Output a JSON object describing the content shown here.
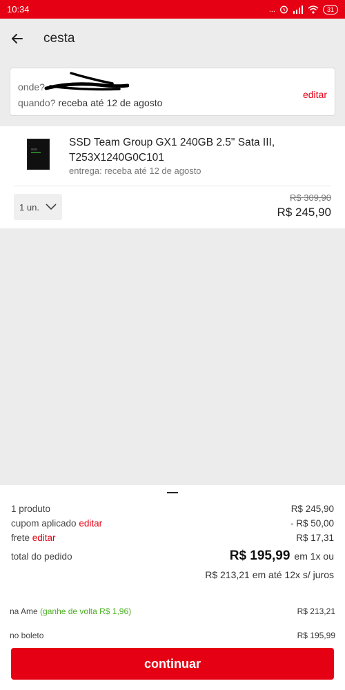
{
  "status_bar": {
    "time": "10:34",
    "dots": "...",
    "battery": "31"
  },
  "header": {
    "title": "cesta"
  },
  "delivery": {
    "where_label": "onde?",
    "when_label": "quando?",
    "when_value": "receba até 12 de agosto",
    "edit_label": "editar"
  },
  "product": {
    "name_line1": "SSD Team Group GX1 240GB 2.5\" Sata III,",
    "name_line2": "T253X1240G0C101",
    "delivery": "entrega: receba até 12 de agosto",
    "quantity": "1 un.",
    "old_price": "R$ 309,90",
    "price": "R$ 245,90"
  },
  "summary": {
    "products_label": "1 produto",
    "products_value": "R$ 245,90",
    "coupon_label": "cupom aplicado",
    "coupon_edit": "editar",
    "coupon_value": "- R$ 50,00",
    "shipping_label": "frete",
    "shipping_edit": "editar",
    "shipping_value": "R$ 17,31",
    "total_label": "total do pedido",
    "total_value": "R$ 195,99",
    "total_suffix": "em 1x ou",
    "installments": "R$ 213,21 em até 12x s/ juros",
    "ame_label": "na Ame",
    "ame_cashback": "(ganhe de volta R$ 1,96)",
    "ame_value": "R$ 213,21",
    "boleto_label": "no boleto",
    "boleto_value": "R$ 195,99"
  },
  "continue_label": "continuar",
  "colors": {
    "brand_red": "#e60014",
    "discount_green": "#4caf23",
    "background": "#ececec"
  },
  "icons": [
    "back-arrow-icon",
    "alarm-icon",
    "signal-icon",
    "wifi-icon",
    "battery-icon",
    "chevron-down-icon"
  ]
}
